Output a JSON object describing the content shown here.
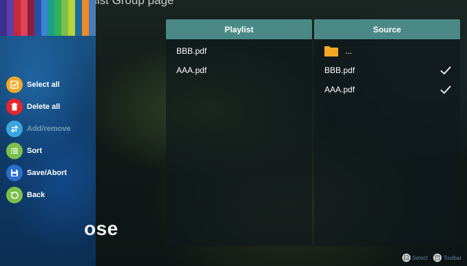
{
  "header": {
    "top_text": "Edit Playlist Group page"
  },
  "sidebar": {
    "items": [
      {
        "label": "Select all",
        "icon": "checkbox-icon",
        "color": "#f0a928",
        "enabled": true
      },
      {
        "label": "Delete all",
        "icon": "trash-icon",
        "color": "#e5262b",
        "enabled": true
      },
      {
        "label": "Add/remove",
        "icon": "swap-arrows-icon",
        "color": "#3ba7e0",
        "enabled": false
      },
      {
        "label": "Sort",
        "icon": "list-icon",
        "color": "#7cc04a",
        "enabled": true
      },
      {
        "label": "Save/Abort",
        "icon": "save-icon",
        "color": "#2a6fcd",
        "enabled": true
      },
      {
        "label": "Back",
        "icon": "back-arrow-icon",
        "color": "#7cc04a",
        "enabled": true
      }
    ]
  },
  "background_word": "ose",
  "playlist": {
    "title": "Playlist",
    "files": [
      "BBB.pdf",
      "AAA.pdf"
    ]
  },
  "source": {
    "title": "Source",
    "parent_folder": "...",
    "files": [
      {
        "name": "BBB.pdf",
        "checked": true
      },
      {
        "name": "AAA.pdf",
        "checked": true
      }
    ]
  },
  "footer": {
    "select_label": "Select",
    "toolbar_label": "Toolbar"
  },
  "colors": {
    "header_teal": "#4a8986",
    "folder_orange": "#f5a623",
    "sidebar_blue": "#1d5a8f"
  }
}
